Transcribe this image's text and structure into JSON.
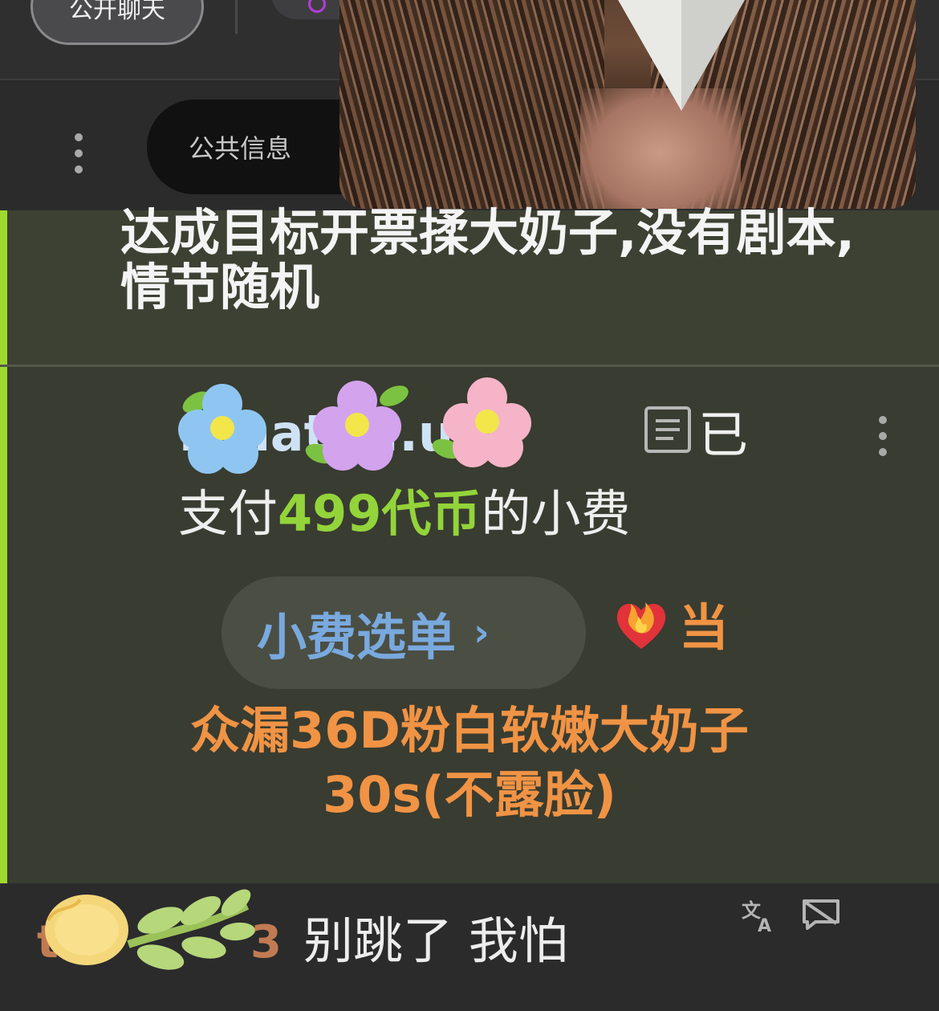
{
  "topbar": {
    "public_chat_tab": "公开聊天"
  },
  "toolbar": {
    "public_info_label": "公共信息"
  },
  "messages": {
    "room_topic": "达成目标开票揉大奶子,没有剧本,情节随机",
    "tip": {
      "username": "...nate...uler",
      "already_label": "已",
      "paid_prefix": "支付",
      "amount": "499代币",
      "paid_suffix": "的小费",
      "tip_menu_label": "小费选单",
      "tip_menu_chevron": "›",
      "item_prefix": "当",
      "item_text": "众漏36D粉白软嫩大奶子30s(不露脸)"
    },
    "chat": {
      "username": "t",
      "username_suffix": "3",
      "text": "别跳了 我怕"
    }
  },
  "icons": {
    "translate": "translate-icon",
    "hide": "hide-message-icon",
    "fire_heart": "heart-on-fire-icon",
    "user_note": "document-icon"
  },
  "colors": {
    "accent_green": "#93d43a",
    "tip_orange": "#f09344",
    "tip_menu_blue": "#79a9de",
    "message_bar": "#9fd92e"
  }
}
